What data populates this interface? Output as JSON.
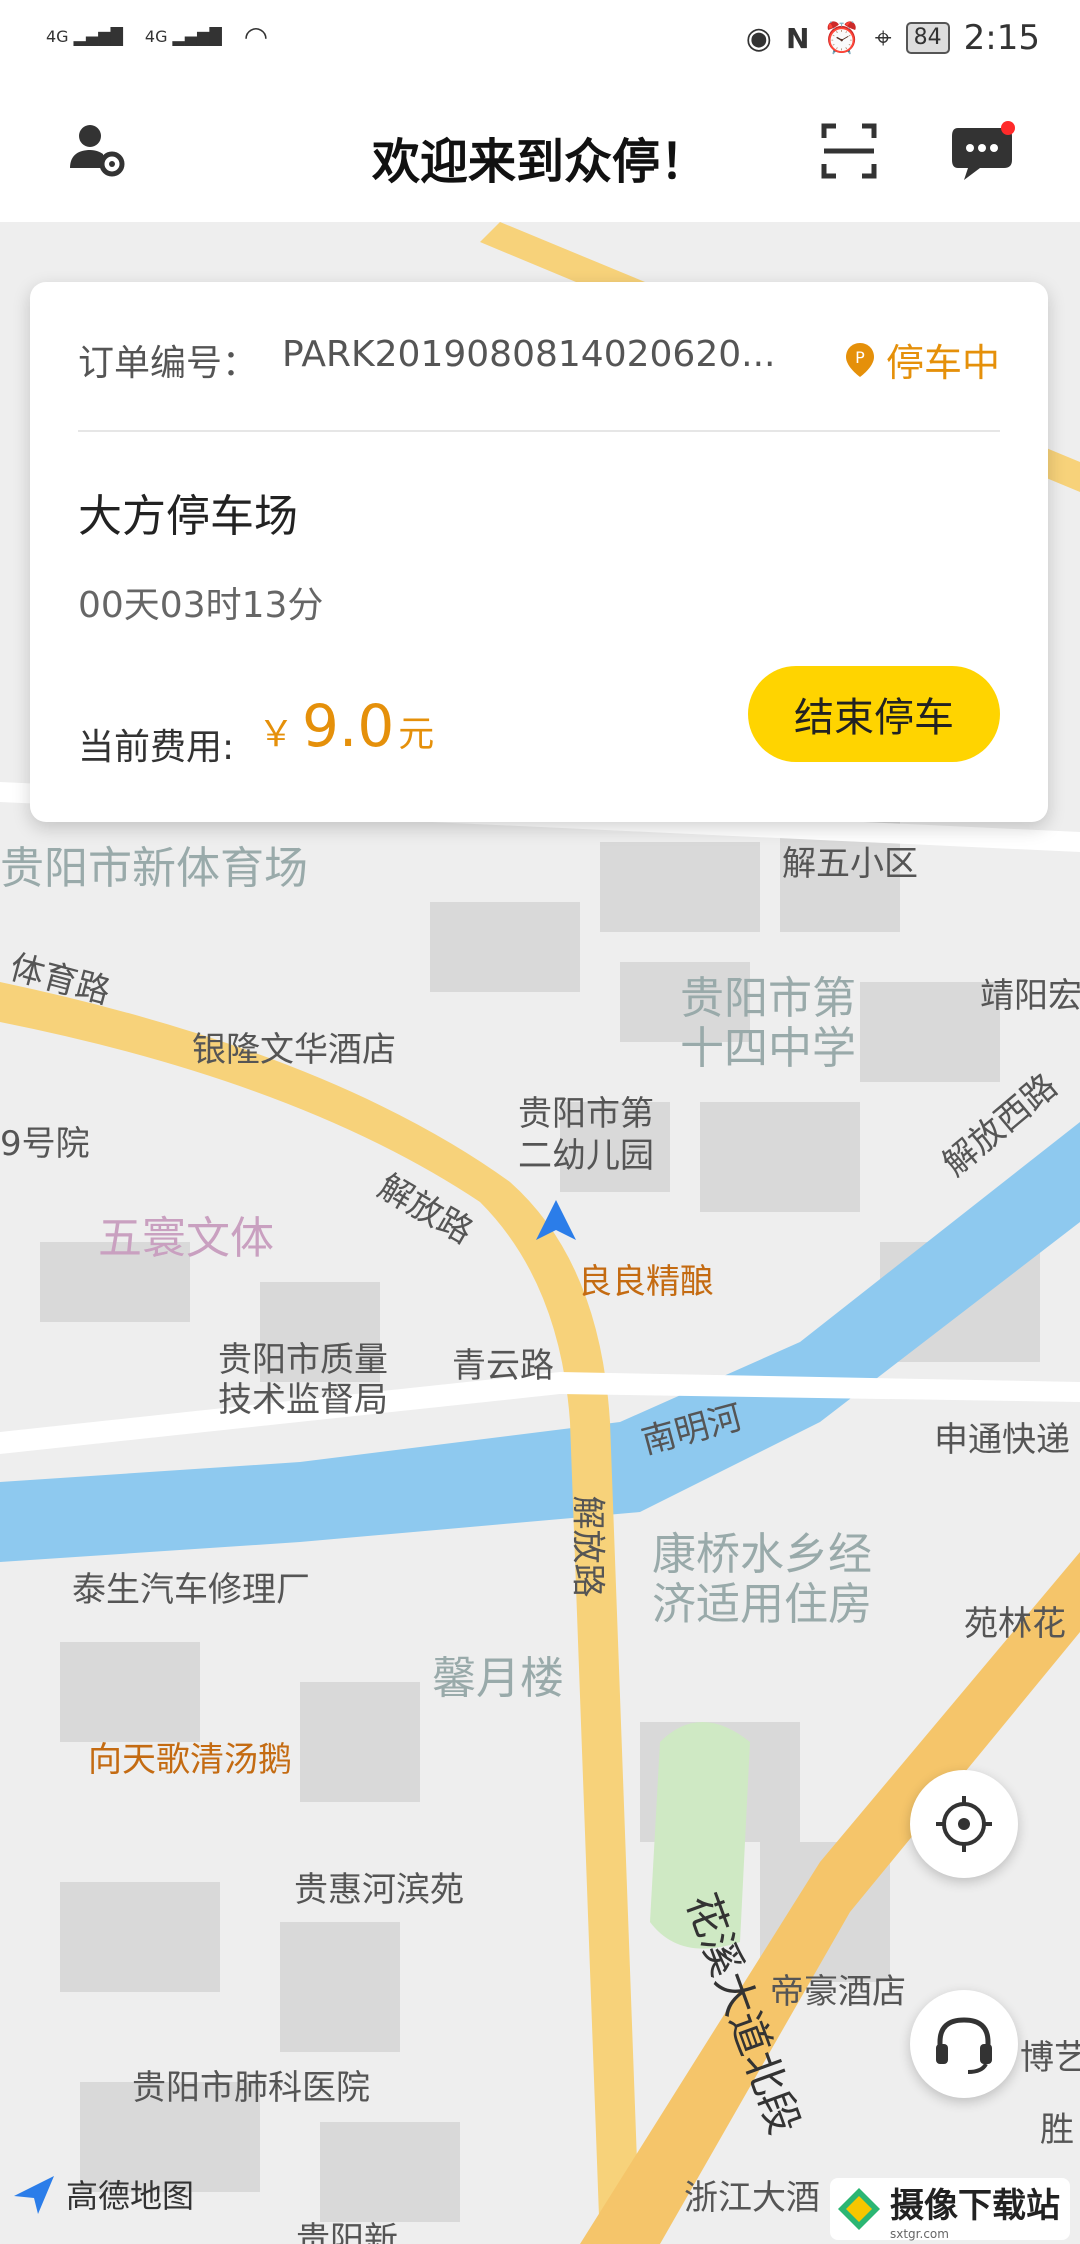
{
  "status_bar": {
    "signal1": "4G",
    "signal2": "4G",
    "battery": "84",
    "time": "2:15"
  },
  "header": {
    "title": "欢迎来到众停！"
  },
  "order": {
    "label": "订单编号：",
    "number": "PARK2019080814020620...",
    "status": "停车中",
    "lot_name": "大方停车场",
    "duration": "00天03时13分",
    "fee_label": "当前费用:",
    "currency": "￥",
    "amount": "9.0",
    "unit": "元",
    "end_button": "结束停车"
  },
  "map": {
    "labels": [
      "贵阳市新体育场",
      "体育路",
      "银隆文华酒店",
      "解五小区",
      "贵阳市第",
      "十四中学",
      "靖阳宏",
      "解放西路",
      "贵阳市第",
      "二幼儿园",
      "9号院",
      "五寰文体",
      "解放路",
      "良良精酿",
      "贵阳市质量",
      "技术监督局",
      "青云路",
      "南明河",
      "申通快递",
      "解放路",
      "康桥水乡经",
      "济适用住房",
      "泰生汽车修理厂",
      "苑林花",
      "馨月楼",
      "向天歌清汤鹅",
      "贵惠河滨苑",
      "花溪大道北段",
      "帝豪酒店",
      "博艺",
      "贵阳市肺科医院",
      "浙江大酒",
      "贵阳新",
      "胜"
    ],
    "provider": "高德地图"
  },
  "watermark": {
    "text": "摄像下载站",
    "sub": "sxtgr.com"
  },
  "colors": {
    "accent": "#ffd400",
    "status": "#e5900a",
    "river": "#8ec9ef",
    "road": "#f7d27a"
  }
}
